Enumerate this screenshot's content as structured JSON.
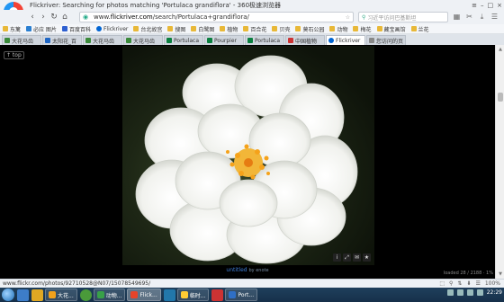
{
  "window": {
    "title": "Flickriver: Searching for photos matching 'Portulaca grandiflora' - 360极速浏览器",
    "controls": [
      "≡",
      "–",
      "□",
      "×"
    ]
  },
  "nav": {
    "back": "‹",
    "forward": "›",
    "reload": "↻",
    "home": "⌂",
    "url_prefix": "www.",
    "url_domain": "flickriver.com",
    "url_path": "/search/Portulaca+grandiflora/",
    "search_placeholder": "习近平访问巴基斯坦",
    "right_icons": [
      "▦",
      "✂",
      "⤓",
      "☰"
    ]
  },
  "bookmarks": [
    "东篱",
    "必应 图片",
    "百度百科",
    "Flickriver",
    "台北故宫",
    "搜图",
    "白鹭图",
    "植物",
    "百合花",
    "贝壳",
    "莫石公园",
    "动物",
    "梅花",
    "藏宝画馆",
    "兰花"
  ],
  "tabs": [
    {
      "label": "大花马齿",
      "color": "#3a8a3a",
      "active": false
    },
    {
      "label": "太阳花_百",
      "color": "#1e66c4",
      "active": false
    },
    {
      "label": "大花马齿",
      "color": "#3a8a3a",
      "active": false
    },
    {
      "label": "大花马齿",
      "color": "#3a8a3a",
      "active": false
    },
    {
      "label": "Portulaca",
      "color": "#0a7f3f",
      "active": false
    },
    {
      "label": "Pourpier",
      "color": "#0a7f3f",
      "active": false
    },
    {
      "label": "Portulaca",
      "color": "#0a7f3f",
      "active": false
    },
    {
      "label": "中国植物",
      "color": "#c33",
      "active": false
    },
    {
      "label": "Flickriver",
      "color": "#0064d2",
      "active": true
    },
    {
      "label": "您访问的页",
      "color": "#888",
      "active": false
    }
  ],
  "content": {
    "top_badge": "↑ top",
    "caption_title": "untitled",
    "caption_by": "by enote",
    "loaded": "loaded 28 / 2188 · 1%",
    "photo_tools": [
      "i",
      "⤢",
      "✉",
      "★"
    ]
  },
  "status": {
    "link": "www.flickr.com/photos/92710528@N07/15078549695/",
    "right": [
      "⬚",
      "⚲",
      "⇅",
      "⬇",
      "☰",
      "100%"
    ]
  },
  "taskbar": {
    "tasks": [
      {
        "label": "大花...",
        "color": "#f1a11c",
        "active": false
      },
      {
        "label": "动物...",
        "color": "#38a048",
        "active": false
      },
      {
        "label": "Flick...",
        "color": "#e7442a",
        "active": true
      },
      {
        "label": "临时...",
        "color": "#ffcc33",
        "active": false
      },
      {
        "label": "Port...",
        "color": "#2f6fc5",
        "active": false
      }
    ],
    "clock": "22:29"
  }
}
